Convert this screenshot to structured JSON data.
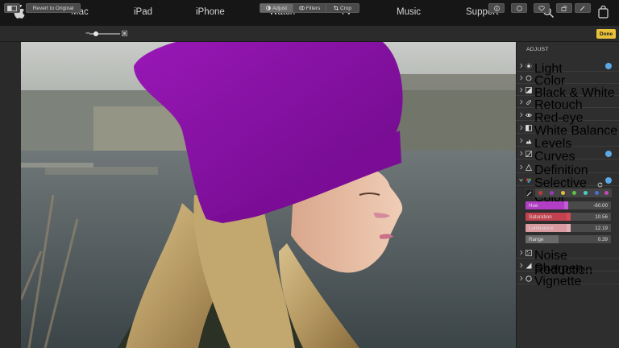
{
  "nav": {
    "items": [
      "Mac",
      "iPad",
      "iPhone",
      "Watch",
      "TV",
      "Music",
      "Support"
    ]
  },
  "toolbar": {
    "revert_label": "Revert to Original",
    "tabs": [
      "Adjust",
      "Filters",
      "Crop"
    ],
    "active_tab": "Adjust",
    "done_label": "Done"
  },
  "panel": {
    "title": "ADJUST",
    "items": [
      {
        "label": "Light",
        "icon": "sun-icon",
        "checked": true
      },
      {
        "label": "Color",
        "icon": "circle-icon",
        "checked": false
      },
      {
        "label": "Black & White",
        "icon": "half-square-icon",
        "checked": false
      },
      {
        "label": "Retouch",
        "icon": "bandage-icon",
        "checked": false
      },
      {
        "label": "Red-eye",
        "icon": "eye-icon",
        "checked": false
      },
      {
        "label": "White Balance",
        "icon": "white-balance-icon",
        "checked": false
      },
      {
        "label": "Levels",
        "icon": "levels-icon",
        "checked": false
      },
      {
        "label": "Curves",
        "icon": "curves-icon",
        "checked": true
      },
      {
        "label": "Definition",
        "icon": "triangle-icon",
        "checked": false
      },
      {
        "label": "Selective Color",
        "icon": "selective-color-icon",
        "checked": true
      },
      {
        "label": "Noise Reduction",
        "icon": "noise-icon",
        "checked": false
      },
      {
        "label": "Sharpen",
        "icon": "sharpen-icon",
        "checked": false
      },
      {
        "label": "Vignette",
        "icon": "vignette-icon",
        "checked": false
      }
    ],
    "selective_color": {
      "swatches": [
        "#c23b3b",
        "#9c3bb8",
        "#e0c13c",
        "#5cc24a",
        "#4ad0c9",
        "#4670d6",
        "#c24ab8"
      ],
      "sliders": [
        {
          "label": "Hue",
          "value": "-60.00",
          "level": 0.5,
          "color": "#b23ec6"
        },
        {
          "label": "Saturation",
          "value": "10.56",
          "level": 0.53,
          "color": "#c2434f"
        },
        {
          "label": "Luminance",
          "value": "12.19",
          "level": 0.53,
          "color": "#d99aa0"
        },
        {
          "label": "Range",
          "value": "0.39",
          "level": 0.39,
          "color": "#6a6a6a"
        }
      ]
    }
  },
  "colors": {
    "accent_done": "#e8c23a",
    "check_blue": "#5aa9e6",
    "beanie_purple": "#8e0fa8"
  }
}
